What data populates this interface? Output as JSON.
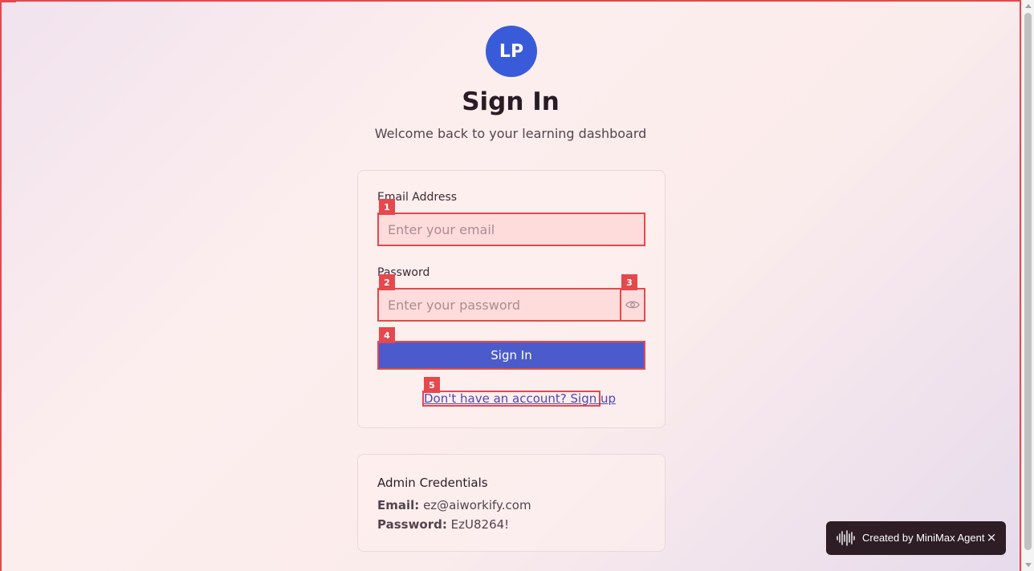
{
  "app": {
    "logo_initials": "LP",
    "title": "Sign In",
    "subtitle": "Welcome back to your learning dashboard"
  },
  "login_form": {
    "email_label": "Email Address",
    "email_placeholder": "Enter your email",
    "email_value": "",
    "password_label": "Password",
    "password_placeholder": "Enter your password",
    "password_value": "",
    "password_toggle_icon": "eye-icon",
    "submit_label": "Sign In",
    "signup_link_text": "Don't have an account? Sign up"
  },
  "markers": [
    "1",
    "2",
    "3",
    "4",
    "5"
  ],
  "admin": {
    "title": "Admin Credentials",
    "email_label": "Email:",
    "email_value": "ez@aiworkify.com",
    "password_label": "Password:",
    "password_value": "EzU8264!"
  },
  "toast": {
    "text": "Created by MiniMax Agent",
    "icon": "waveform-icon",
    "close_icon": "close-icon",
    "close_symbol": "×"
  },
  "colors": {
    "accent": "#3a5bd9",
    "button": "#4b5bcb",
    "highlight_border": "#e5484d",
    "link": "#4c46b6",
    "toast_bg": "#2e1d24"
  }
}
